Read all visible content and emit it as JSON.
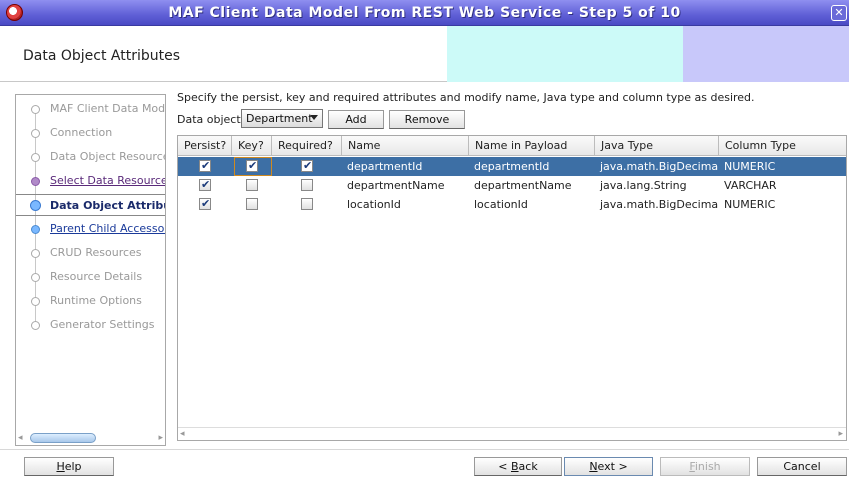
{
  "window": {
    "title": "MAF Client Data Model From REST Web Service - Step 5 of 10",
    "close_glyph": "✕"
  },
  "header": {
    "title": "Data Object Attributes"
  },
  "nav": {
    "steps": [
      {
        "label": "MAF Client Data Model",
        "state": "done"
      },
      {
        "label": "Connection",
        "state": "done"
      },
      {
        "label": "Data Object Resources",
        "state": "done"
      },
      {
        "label": "Select Data Resources",
        "state": "visited"
      },
      {
        "label": "Data Object Attributes",
        "state": "current"
      },
      {
        "label": "Parent Child Accessors",
        "state": "link"
      },
      {
        "label": "CRUD Resources",
        "state": "todo"
      },
      {
        "label": "Resource Details",
        "state": "todo"
      },
      {
        "label": "Runtime Options",
        "state": "todo"
      },
      {
        "label": "Generator Settings",
        "state": "todo"
      }
    ],
    "scroll_left": "◂",
    "scroll_right": "▸"
  },
  "main": {
    "description": "Specify the persist, key and required attributes and modify name, Java type and column type as desired.",
    "data_object_label": "Data object",
    "data_object_value": "Department",
    "add_label": "Add",
    "remove_label": "Remove"
  },
  "table": {
    "columns": [
      "Persist?",
      "Key?",
      "Required?",
      "Name",
      "Name in Payload",
      "Java Type",
      "Column Type"
    ],
    "rows": [
      {
        "persist": true,
        "key": true,
        "required": true,
        "name": "departmentId",
        "payload": "departmentId",
        "java_type": "java.math.BigDecimal",
        "column_type": "NUMERIC"
      },
      {
        "persist": true,
        "key": false,
        "required": false,
        "name": "departmentName",
        "payload": "departmentName",
        "java_type": "java.lang.String",
        "column_type": "VARCHAR"
      },
      {
        "persist": true,
        "key": false,
        "required": false,
        "name": "locationId",
        "payload": "locationId",
        "java_type": "java.math.BigDecimal",
        "column_type": "NUMERIC"
      }
    ],
    "selected_row": 0,
    "check_glyph": "✔",
    "scroll_left": "◂",
    "scroll_right": "▸"
  },
  "footer": {
    "help": {
      "mnemonic": "H",
      "rest": "elp"
    },
    "back": {
      "prefix": "< ",
      "mnemonic": "B",
      "rest": "ack"
    },
    "next": {
      "mnemonic": "N",
      "rest": "ext >"
    },
    "finish": {
      "mnemonic": "F",
      "rest": "inish"
    },
    "cancel": "Cancel"
  },
  "colors": {
    "title_bar": "#5f5fd6",
    "selection": "#3d6fa5",
    "header_cyan": "#ccfaf8",
    "header_lavender": "#c8c8fa"
  }
}
